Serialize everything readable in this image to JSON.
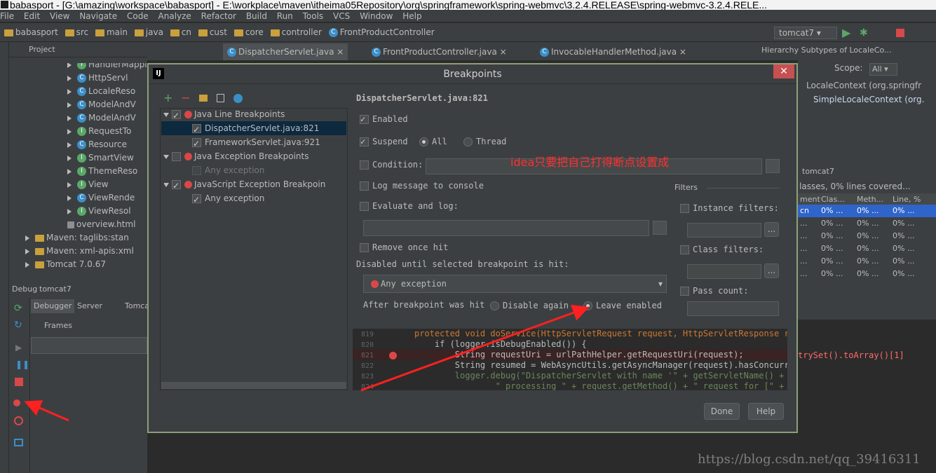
{
  "window": {
    "title": "babasport - [G:\\amazing\\workspace\\babasport] - E:\\workplace\\maven\\itheima05Repository\\org\\springframework\\spring-webmvc\\3.2.4.RELEASE\\spring-webmvc-3.2.4.RELE..."
  },
  "menu": [
    "File",
    "Edit",
    "View",
    "Navigate",
    "Code",
    "Analyze",
    "Refactor",
    "Build",
    "Run",
    "Tools",
    "VCS",
    "Window",
    "Help"
  ],
  "breadcrumbs": [
    "babasport",
    "src",
    "main",
    "java",
    "cn",
    "cust",
    "core",
    "controller",
    "FrontProductController"
  ],
  "run_config": "tomcat7",
  "project_panel": {
    "label": "Project"
  },
  "editor_tabs": [
    "DispatcherServlet.java",
    "FrontProductController.java",
    "InvocableHandlerMethod.java"
  ],
  "project_tree": [
    "HandlerMapping",
    "HttpServl",
    "LocaleReso",
    "ModelAndV",
    "ModelAndV",
    "RequestTo",
    "Resource",
    "SmartView",
    "ThemeReso",
    "View",
    "ViewRende",
    "ViewResol"
  ],
  "project_tree_extra": [
    "overview.html",
    "Maven: taglibs:stan",
    "Maven: xml-apis:xml",
    "Tomcat 7.0.67"
  ],
  "hierarchy": {
    "title": "Hierarchy Subtypes of LocaleCo...",
    "scope_label": "Scope:",
    "scope_value": "All",
    "items": [
      "LocaleContext (org.springfr",
      "SimpleLocaleContext (org."
    ]
  },
  "coverage": {
    "title": "tomcat7",
    "summary": "lasses, 0% lines covered...",
    "headers": [
      "ment",
      "Clas...",
      "Meth...",
      "Line, %"
    ],
    "rows": [
      [
        "cn",
        "0% ...",
        "0% ...",
        "0% ..."
      ],
      [
        "...",
        "0% ...",
        "0% ...",
        "0% ..."
      ],
      [
        "...",
        "0% ...",
        "0% ...",
        "0% ..."
      ],
      [
        "...",
        "0% ...",
        "0% ...",
        "0% ..."
      ],
      [
        "...",
        "0% ...",
        "0% ...",
        "0% ..."
      ],
      [
        "...",
        "0% ...",
        "0% ...",
        "0% ..."
      ]
    ]
  },
  "debug_panel": {
    "title": "Debug",
    "config": "tomcat7",
    "tabs": [
      "Debugger",
      "Server",
      "Tomca"
    ],
    "frames_label": "Frames"
  },
  "dialog": {
    "title": "Breakpoints",
    "categories": [
      {
        "label": "Java Line Breakpoints",
        "children": [
          "DispatcherServlet.java:821",
          "FrameworkServlet.java:921"
        ]
      },
      {
        "label": "Java Exception Breakpoints",
        "children": [
          "Any exception"
        ]
      },
      {
        "label": "JavaScript Exception Breakpoin",
        "children": [
          "Any exception"
        ]
      }
    ],
    "detail_title": "DispatcherServlet.java:821",
    "enabled_label": "Enabled",
    "suspend_label": "Suspend",
    "suspend_all": "All",
    "suspend_thread": "Thread",
    "condition_label": "Condition:",
    "log_message_label": "Log message to console",
    "evaluate_label": "Evaluate and log:",
    "remove_once_label": "Remove once hit",
    "disabled_until_label": "Disabled until selected breakpoint is hit:",
    "disabled_until_value": "Any exception",
    "after_hit_label": "After breakpoint was hit",
    "disable_again": "Disable again",
    "leave_enabled": "Leave enabled",
    "filters_label": "Filters",
    "instance_filters": "Instance filters:",
    "class_filters": "Class filters:",
    "pass_count": "Pass count:",
    "done": "Done",
    "help": "Help"
  },
  "code": [
    {
      "num": "819",
      "text": "protected void doService(HttpServletRequest request, HttpServletResponse res"
    },
    {
      "num": "820",
      "text": "    if (logger.isDebugEnabled()) {"
    },
    {
      "num": "821",
      "text": "        String requestUri = urlPathHelper.getRequestUri(request);"
    },
    {
      "num": "822",
      "text": "        String resumed = WebAsyncUtils.getAsyncManager(request).hasConcurren"
    },
    {
      "num": "823",
      "text": "        logger.debug(\"DispatcherServlet with name '\" + getServletName() + \""
    },
    {
      "num": "824",
      "text": "                \" processing \" + request.getMethod() + \" request for [\" + re"
    }
  ],
  "side_code": "trySet().toArray()[1]",
  "annotation": "idea只要把自己打得断点设置成",
  "watermark": "https://blog.csdn.net/qq_39416311",
  "colors": {
    "annotation": "#ff3030",
    "breakpoint": "#d94848",
    "ide_bg": "#3c3f41",
    "editor_bg": "#2b2b2b"
  }
}
